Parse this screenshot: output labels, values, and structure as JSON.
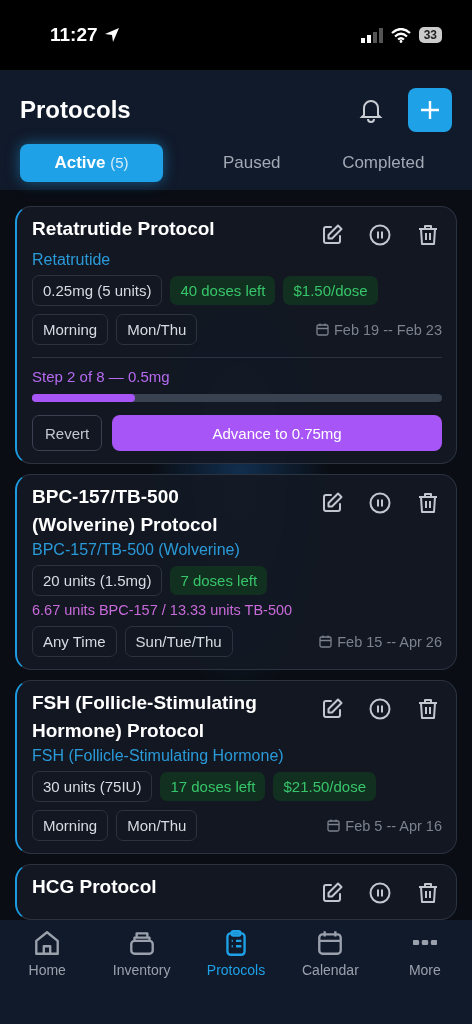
{
  "status_bar": {
    "time": "11:27",
    "battery": "33"
  },
  "header": {
    "title": "Protocols"
  },
  "tabs": [
    {
      "label": "Active",
      "count": "(5)",
      "selected": true
    },
    {
      "label": "Paused",
      "selected": false
    },
    {
      "label": "Completed",
      "selected": false
    }
  ],
  "protocols": [
    {
      "title": "Retatrutide Protocol",
      "compound": "Retatrutide",
      "chips": [
        {
          "text": "0.25mg (5 units)",
          "kind": "dose"
        },
        {
          "text": "40 doses left",
          "kind": "stock"
        },
        {
          "text": "$1.50/dose",
          "kind": "stock"
        }
      ],
      "schedule": [
        "Morning",
        "Mon/Thu"
      ],
      "dates": "Feb 19 -- Feb 23",
      "step": {
        "label": "Step 2 of 8 — 0.5mg",
        "level": 0.25,
        "revert": "Revert",
        "advance": "Advance to 0.75mg"
      }
    },
    {
      "title": "BPC-157/TB-500 (Wolverine) Protocol",
      "compound": "BPC-157/TB-500 (Wolverine)",
      "chips": [
        {
          "text": "20 units (1.5mg)",
          "kind": "dose"
        },
        {
          "text": "7 doses left",
          "kind": "stock"
        }
      ],
      "blend": "6.67 units BPC-157 / 13.33 units TB-500",
      "schedule": [
        "Any Time",
        "Sun/Tue/Thu"
      ],
      "dates": "Feb 15 -- Apr 26"
    },
    {
      "title": "FSH (Follicle-Stimulating Hormone) Protocol",
      "compound": "FSH (Follicle-Stimulating Hormone)",
      "chips": [
        {
          "text": "30 units (75IU)",
          "kind": "dose"
        },
        {
          "text": "17 doses left",
          "kind": "stock"
        },
        {
          "text": "$21.50/dose",
          "kind": "stock"
        }
      ],
      "schedule": [
        "Morning",
        "Mon/Thu"
      ],
      "dates": "Feb 5 -- Apr 16"
    },
    {
      "title": "HCG Protocol"
    }
  ],
  "nav": [
    {
      "label": "Home",
      "selected": false
    },
    {
      "label": "Inventory",
      "selected": false
    },
    {
      "label": "Protocols",
      "selected": true
    },
    {
      "label": "Calendar",
      "selected": false
    },
    {
      "label": "More",
      "selected": false
    }
  ]
}
